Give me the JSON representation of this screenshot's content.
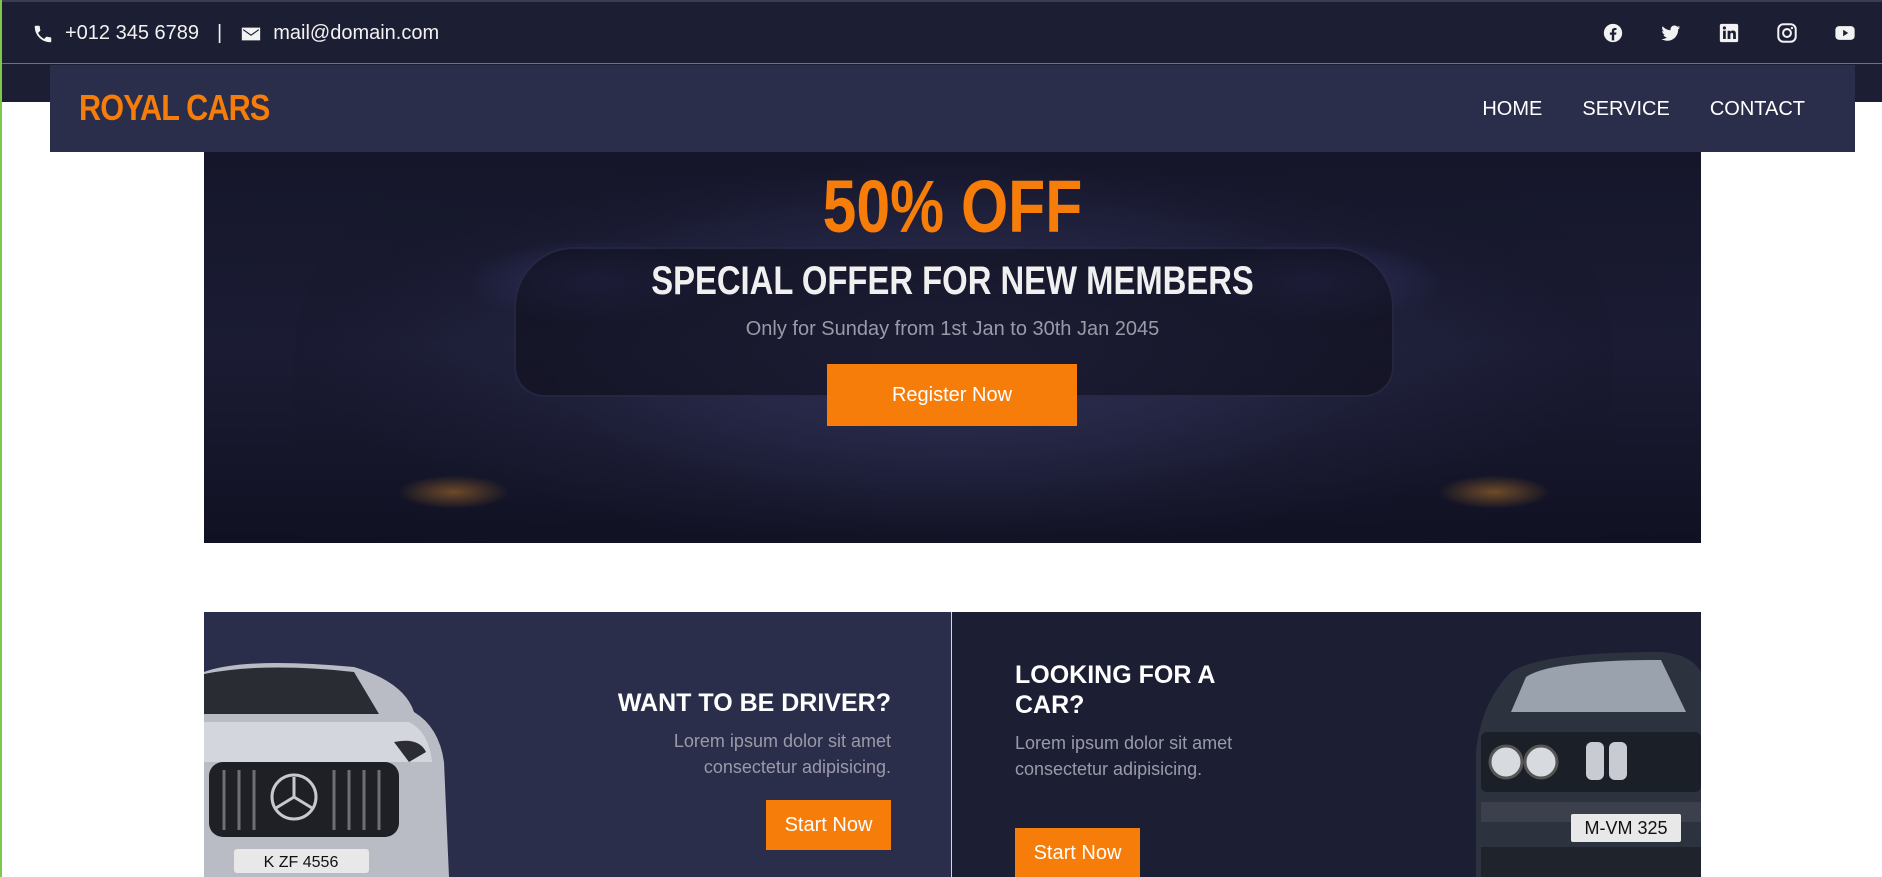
{
  "topbar": {
    "phone": "+012 345 6789",
    "separator": "|",
    "email": "mail@domain.com",
    "socials": [
      "facebook-icon",
      "twitter-icon",
      "linkedin-icon",
      "instagram-icon",
      "youtube-icon"
    ]
  },
  "brand": {
    "name": "ROYAL CARS",
    "accent": "#f77d0a"
  },
  "nav": {
    "home": "HOME",
    "service": "SERVICE",
    "contact": "CONTACT"
  },
  "hero": {
    "offer": "50% OFF",
    "subtitle": "SPECIAL OFFER FOR NEW MEMBERS",
    "description": "Only for Sunday from 1st Jan to 30th Jan 2045",
    "button": "Register Now"
  },
  "panels": {
    "driver": {
      "title": "WANT TO BE DRIVER?",
      "text": "Lorem ipsum dolor sit amet consectetur adipisicing.",
      "button": "Start Now"
    },
    "car": {
      "title": "LOOKING FOR A CAR?",
      "text": "Lorem ipsum dolor sit amet consectetur adipisicing.",
      "button": "Start Now"
    },
    "plates": {
      "left": "K ZF 4556",
      "right": "M-VM 325"
    }
  },
  "colors": {
    "dark": "#1c1e33",
    "navy": "#2b2e4a",
    "orange": "#f77d0a"
  }
}
